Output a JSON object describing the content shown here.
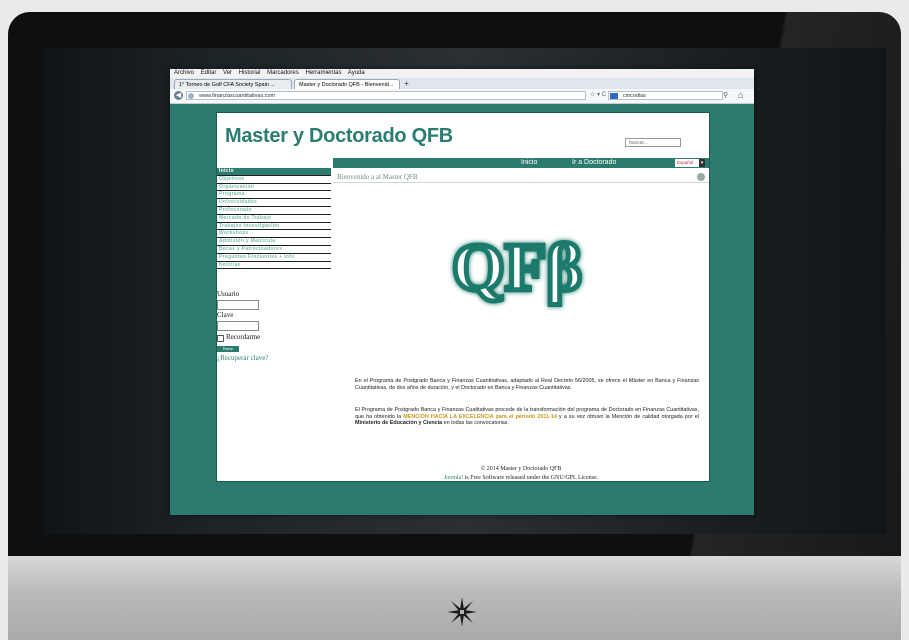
{
  "browser": {
    "menu": [
      "Archivo",
      "Editar",
      "Ver",
      "Historial",
      "Marcadores",
      "Herramientas",
      "Ayuda"
    ],
    "tabs": [
      "1° Torneo de Golf CFA Society Spain ...",
      "Master y Doctorado QFB - Bienvenid..."
    ],
    "new_tab": "+",
    "url": "www.finanzascuantitativas.com",
    "search_value": "cincodias"
  },
  "site": {
    "title": "Master y Doctorado QFB",
    "search_placeholder": "buscar...",
    "topnav": [
      "Inicio",
      "Ir a Doctorado"
    ],
    "language": "Español",
    "menu": [
      "Inicio",
      "Objetivos",
      "Organización",
      "Programa",
      "Universidades",
      "Profesorado",
      "Mercado de Trabajo",
      "Trabajos investigación",
      "Workshops",
      "Admisión y Matrícula",
      "Becas y Patrocinadores",
      "Preguntas Frecuentes + Info",
      "Noticias"
    ],
    "login": {
      "user_label": "Usuario",
      "password_label": "Clave",
      "remember_label": "Recordarme",
      "button_label": "Entrar",
      "recover_link": "¿Recuperar clave?"
    },
    "welcome": "Bienvenido a al Master QFB",
    "logo_text": "QFβ",
    "para1": "En el Programa de Postgrado Banca y Finanzas Cuantitativas, adaptado al Real Decreto 56/2005, se ofrece el Máster en Banca y Finanzas Cuantitativas, de dos años de duración, y el Doctorado en Banca y Finanzas Cuantitativas.",
    "para2_a": "El Programa de Postgrado Banca y Finanzas Cuatitativas procede de la transformación del programa de Doctorado en Finanzas Cuantitativas, que ha obtenido la ",
    "para2_hl": "MENCIÓN HACIA LA EXCELENCIA para el periodo 2011-14",
    "para2_b": " y a su vez obtuvo la Mención de calidad otorgada por el ",
    "para2_bold": "Ministerio de Educación y Ciencia",
    "para2_c": " en todas las convocatorias.",
    "footer_copyright": "© 2014 Master y Doctorado QFB",
    "footer_joomla": "Joomla!",
    "footer_license": " is Free Software released under the GNU/GPL License."
  },
  "colors": {
    "site_teal": "#2b7b6e",
    "highlight": "#c79a1a"
  }
}
